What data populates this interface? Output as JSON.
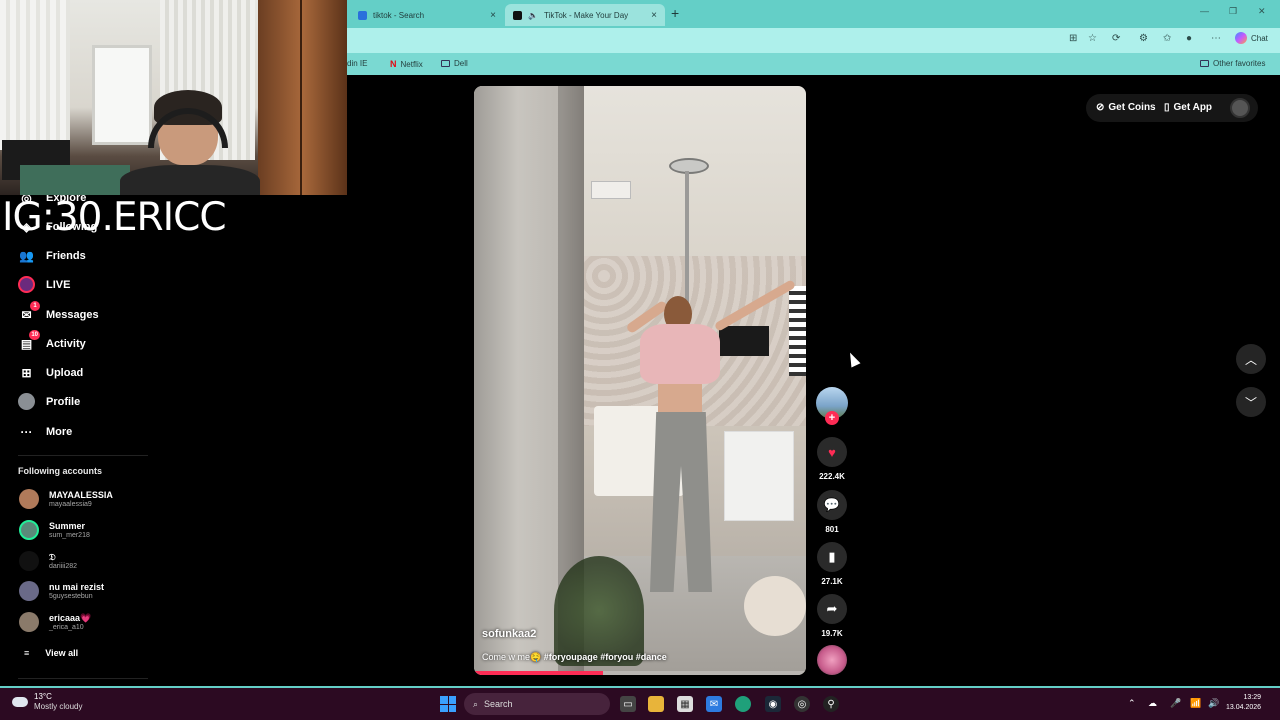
{
  "browser": {
    "tabs": [
      {
        "label": "tiktok - Search",
        "active": false
      },
      {
        "label": "TikTok - Make Your Day",
        "active": true
      }
    ],
    "chat_label": "Chat",
    "bookmarks": [
      {
        "label": "din IE"
      },
      {
        "label": "Netflix"
      },
      {
        "label": "Dell"
      }
    ],
    "other_favorites": "Other favorites"
  },
  "webcam_overlay": {
    "caption": "IG:30.ERICC"
  },
  "sidebar": {
    "nav": [
      {
        "label": "Explore",
        "icon": "compass-icon"
      },
      {
        "label": "Following",
        "icon": "following-icon"
      },
      {
        "label": "Friends",
        "icon": "friends-icon"
      },
      {
        "label": "LIVE",
        "icon": "live-icon"
      },
      {
        "label": "Messages",
        "icon": "messages-icon",
        "badge": "1"
      },
      {
        "label": "Activity",
        "icon": "activity-icon",
        "badge": "10"
      },
      {
        "label": "Upload",
        "icon": "upload-icon"
      },
      {
        "label": "Profile",
        "icon": "profile-icon"
      },
      {
        "label": "More",
        "icon": "more-icon"
      }
    ],
    "following_title": "Following accounts",
    "accounts": [
      {
        "name": "MAYAALESSIA",
        "handle": "mayaalessia9"
      },
      {
        "name": "Summer",
        "handle": "sum_mer218"
      },
      {
        "name": "𝔇",
        "handle": "dariiii282"
      },
      {
        "name": "nu mai rezist",
        "handle": "5guysestebun"
      },
      {
        "name": "ericaaa💗",
        "handle": "_erica_a10"
      }
    ],
    "view_all": "View all"
  },
  "video": {
    "username": "sofunkaa2",
    "caption": "Come w me🤤",
    "hashtags": "#foryoupage #foryou #dance",
    "progress": 0.39
  },
  "actions": {
    "likes": "222.4K",
    "comments": "801",
    "saves": "27.1K",
    "shares": "19.7K"
  },
  "top_right": {
    "get_coins": "Get Coins",
    "get_app": "Get App"
  },
  "taskbar": {
    "weather_temp": "13°C",
    "weather_desc": "Mostly cloudy",
    "search_placeholder": "Search",
    "time": "13:29",
    "date": "13.04.2026"
  },
  "colors": {
    "accent": "#fe2c55",
    "browser_tabbar": "#64cfc7",
    "taskbar": "#2c0a22"
  }
}
